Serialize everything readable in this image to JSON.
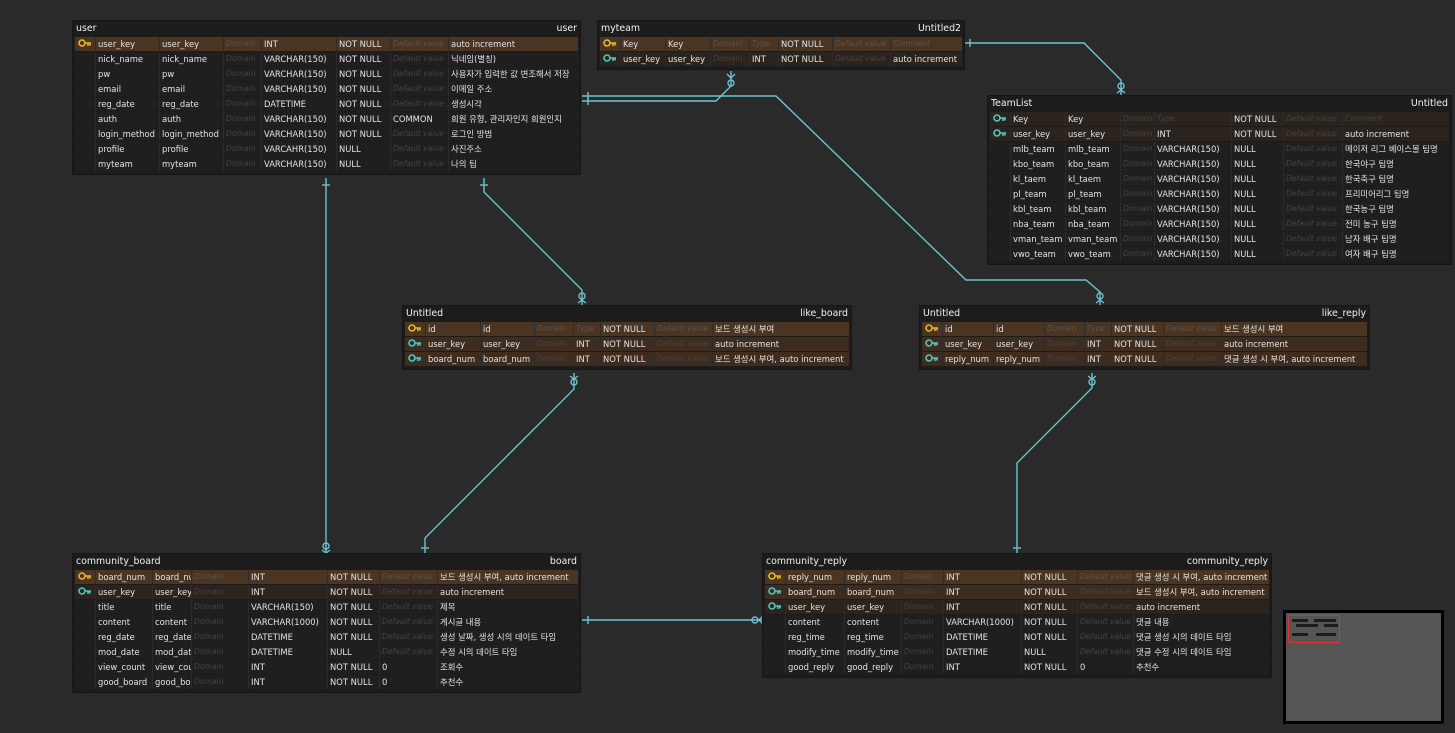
{
  "placeholders": {
    "domain": "Domain",
    "type": "Type",
    "default": "Default value",
    "comment": "Comment"
  },
  "tables": {
    "user": {
      "logical": "user",
      "physical": "user",
      "rows": [
        {
          "key": "pk",
          "logical": "user_key",
          "physical": "user_key",
          "domain": "",
          "type": "INT",
          "nullable": "NOT NULL",
          "default": "",
          "comment": "auto increment"
        },
        {
          "key": "",
          "logical": "nick_name",
          "physical": "nick_name",
          "domain": "",
          "type": "VARCHAR(150)",
          "nullable": "NOT NULL",
          "default": "",
          "comment": "닉네임(별칭)"
        },
        {
          "key": "",
          "logical": "pw",
          "physical": "pw",
          "domain": "",
          "type": "VARCHAR(150)",
          "nullable": "NOT NULL",
          "default": "",
          "comment": "사용자가 입력한 값 변조해서 저장"
        },
        {
          "key": "",
          "logical": "email",
          "physical": "email",
          "domain": "",
          "type": "VARCHAR(150)",
          "nullable": "NOT NULL",
          "default": "",
          "comment": "이메일 주소"
        },
        {
          "key": "",
          "logical": "reg_date",
          "physical": "reg_date",
          "domain": "",
          "type": "DATETIME",
          "nullable": "NOT NULL",
          "default": "",
          "comment": "생성시각"
        },
        {
          "key": "",
          "logical": "auth",
          "physical": "auth",
          "domain": "",
          "type": "VARCHAR(150)",
          "nullable": "NOT NULL",
          "default": "COMMON",
          "comment": "회원 유형, 관리자인지 회원인지"
        },
        {
          "key": "",
          "logical": "login_method",
          "physical": "login_method",
          "domain": "",
          "type": "VARCHAR(150)",
          "nullable": "NOT NULL",
          "default": "",
          "comment": "로그인 방법"
        },
        {
          "key": "",
          "logical": "profile",
          "physical": "profile",
          "domain": "",
          "type": "VARCAHR(150)",
          "nullable": "NULL",
          "default": "",
          "comment": "사진주소"
        },
        {
          "key": "",
          "logical": "myteam",
          "physical": "myteam",
          "domain": "",
          "type": "VARCHAR(150)",
          "nullable": "NULL",
          "default": "",
          "comment": "나의 팀"
        }
      ]
    },
    "myteam": {
      "logical": "myteam",
      "physical": "Untitled2",
      "rows": [
        {
          "key": "pk",
          "logical": "Key",
          "physical": "Key",
          "domain": "",
          "type": "",
          "nullable": "NOT NULL",
          "default": "",
          "comment": ""
        },
        {
          "key": "fk",
          "logical": "user_key",
          "physical": "user_key",
          "domain": "",
          "type": "INT",
          "nullable": "NOT NULL",
          "default": "",
          "comment": "auto increment"
        }
      ]
    },
    "teamlist": {
      "logical": "TeamList",
      "physical": "Untitled",
      "rows": [
        {
          "key": "fk",
          "logical": "Key",
          "physical": "Key",
          "domain": "",
          "type": "",
          "nullable": "NOT NULL",
          "default": "",
          "comment": ""
        },
        {
          "key": "fk",
          "logical": "user_key",
          "physical": "user_key",
          "domain": "",
          "type": "INT",
          "nullable": "NOT NULL",
          "default": "",
          "comment": "auto increment"
        },
        {
          "key": "",
          "logical": "mlb_team",
          "physical": "mlb_team",
          "domain": "",
          "type": "VARCHAR(150)",
          "nullable": "NULL",
          "default": "",
          "comment": "메이저 리그 베이스볼 팀명"
        },
        {
          "key": "",
          "logical": "kbo_team",
          "physical": "kbo_team",
          "domain": "",
          "type": "VARCHAR(150)",
          "nullable": "NULL",
          "default": "",
          "comment": "한국야구 팀명"
        },
        {
          "key": "",
          "logical": "kl_taem",
          "physical": "kl_taem",
          "domain": "",
          "type": "VARCHAR(150)",
          "nullable": "NULL",
          "default": "",
          "comment": "한국축구 팀명"
        },
        {
          "key": "",
          "logical": "pl_team",
          "physical": "pl_team",
          "domain": "",
          "type": "VARCHAR(150)",
          "nullable": "NULL",
          "default": "",
          "comment": "프리미어리그 팀명"
        },
        {
          "key": "",
          "logical": "kbl_team",
          "physical": "kbl_team",
          "domain": "",
          "type": "VARCHAR(150)",
          "nullable": "NULL",
          "default": "",
          "comment": "한국농구 팀명"
        },
        {
          "key": "",
          "logical": "nba_team",
          "physical": "nba_team",
          "domain": "",
          "type": "VARCHAR(150)",
          "nullable": "NULL",
          "default": "",
          "comment": "전미 농구 팀명"
        },
        {
          "key": "",
          "logical": "vman_team",
          "physical": "vman_team",
          "domain": "",
          "type": "VARCHAR(150)",
          "nullable": "NULL",
          "default": "",
          "comment": "남자 배구 팀명"
        },
        {
          "key": "",
          "logical": "vwo_team",
          "physical": "vwo_team",
          "domain": "",
          "type": "VARCHAR(150)",
          "nullable": "NULL",
          "default": "",
          "comment": "여자 배구 팀명"
        }
      ]
    },
    "like_board": {
      "logical": "Untitled",
      "physical": "like_board",
      "rows": [
        {
          "key": "pk",
          "logical": "id",
          "physical": "id",
          "domain": "",
          "type": "",
          "nullable": "NOT NULL",
          "default": "",
          "comment": "보드 생성시 부여"
        },
        {
          "key": "pkfk",
          "logical": "user_key",
          "physical": "user_key",
          "domain": "",
          "type": "INT",
          "nullable": "NOT NULL",
          "default": "",
          "comment": "auto increment"
        },
        {
          "key": "pkfk",
          "logical": "board_num",
          "physical": "board_num",
          "domain": "",
          "type": "INT",
          "nullable": "NOT NULL",
          "default": "",
          "comment": "보드 생성시 부여, auto increment"
        }
      ]
    },
    "like_reply": {
      "logical": "Untitled",
      "physical": "like_reply",
      "rows": [
        {
          "key": "pk",
          "logical": "id",
          "physical": "id",
          "domain": "",
          "type": "",
          "nullable": "NOT NULL",
          "default": "",
          "comment": "보드 생성시 부여"
        },
        {
          "key": "pkfk",
          "logical": "user_key",
          "physical": "user_key",
          "domain": "",
          "type": "INT",
          "nullable": "NOT NULL",
          "default": "",
          "comment": "auto increment"
        },
        {
          "key": "pkfk",
          "logical": "reply_num",
          "physical": "reply_num",
          "domain": "",
          "type": "INT",
          "nullable": "NOT NULL",
          "default": "",
          "comment": "댓글 생성 시 부여, auto increment"
        }
      ]
    },
    "community_board": {
      "logical": "community_board",
      "physical": "board",
      "rows": [
        {
          "key": "pk",
          "logical": "board_num",
          "physical": "board_num",
          "domain": "",
          "type": "INT",
          "nullable": "NOT NULL",
          "default": "",
          "comment": "보드 생성시 부여, auto increment"
        },
        {
          "key": "fk",
          "logical": "user_key",
          "physical": "user_key",
          "domain": "",
          "type": "INT",
          "nullable": "NOT NULL",
          "default": "",
          "comment": "auto increment"
        },
        {
          "key": "",
          "logical": "title",
          "physical": "title",
          "domain": "",
          "type": "VARCHAR(150)",
          "nullable": "NOT NULL",
          "default": "",
          "comment": "제목"
        },
        {
          "key": "",
          "logical": "content",
          "physical": "content",
          "domain": "",
          "type": "VARCHAR(1000)",
          "nullable": "NOT NULL",
          "default": "",
          "comment": "게시글 내용"
        },
        {
          "key": "",
          "logical": "reg_date",
          "physical": "reg_date",
          "domain": "",
          "type": "DATETIME",
          "nullable": "NOT NULL",
          "default": "",
          "comment": "생성 날짜, 생성 시의 데이트 타임"
        },
        {
          "key": "",
          "logical": "mod_date",
          "physical": "mod_date",
          "domain": "",
          "type": "DATETIME",
          "nullable": "NULL",
          "default": "",
          "comment": "수정 시의 데이트 타임"
        },
        {
          "key": "",
          "logical": "view_count",
          "physical": "view_count",
          "domain": "",
          "type": "INT",
          "nullable": "NOT NULL",
          "default": "0",
          "comment": "조회수"
        },
        {
          "key": "",
          "logical": "good_board",
          "physical": "good_board",
          "domain": "",
          "type": "INT",
          "nullable": "NOT NULL",
          "default": "0",
          "comment": "추천수"
        }
      ]
    },
    "community_reply": {
      "logical": "community_reply",
      "physical": "community_reply",
      "rows": [
        {
          "key": "pk",
          "logical": "reply_num",
          "physical": "reply_num",
          "domain": "",
          "type": "INT",
          "nullable": "NOT NULL",
          "default": "",
          "comment": "댓글 생성 시 부여, auto increment"
        },
        {
          "key": "pkfk",
          "logical": "board_num",
          "physical": "board_num",
          "domain": "",
          "type": "INT",
          "nullable": "NOT NULL",
          "default": "",
          "comment": "보드 생성시 부여, auto increment"
        },
        {
          "key": "fk",
          "logical": "user_key",
          "physical": "user_key",
          "domain": "",
          "type": "INT",
          "nullable": "NOT NULL",
          "default": "",
          "comment": "auto increment"
        },
        {
          "key": "",
          "logical": "content",
          "physical": "content",
          "domain": "",
          "type": "VARCHAR(1000)",
          "nullable": "NOT NULL",
          "default": "",
          "comment": "댓글 내용"
        },
        {
          "key": "",
          "logical": "reg_time",
          "physical": "reg_time",
          "domain": "",
          "type": "DATETIME",
          "nullable": "NOT NULL",
          "default": "",
          "comment": "댓글 생성 시의 데이트 타임"
        },
        {
          "key": "",
          "logical": "modify_time",
          "physical": "modify_time",
          "domain": "",
          "type": "DATETIME",
          "nullable": "NULL",
          "default": "",
          "comment": "댓글 수정 시의 데이트 타임"
        },
        {
          "key": "",
          "logical": "good_reply",
          "physical": "good_reply",
          "domain": "",
          "type": "INT",
          "nullable": "NOT NULL",
          "default": "0",
          "comment": "추천수"
        }
      ]
    }
  },
  "colors": {
    "line": "#6cc3cf",
    "pk_key": "#e8b32c",
    "fk_key": "#4fc6c0",
    "canvas": "#2a2a2b"
  }
}
